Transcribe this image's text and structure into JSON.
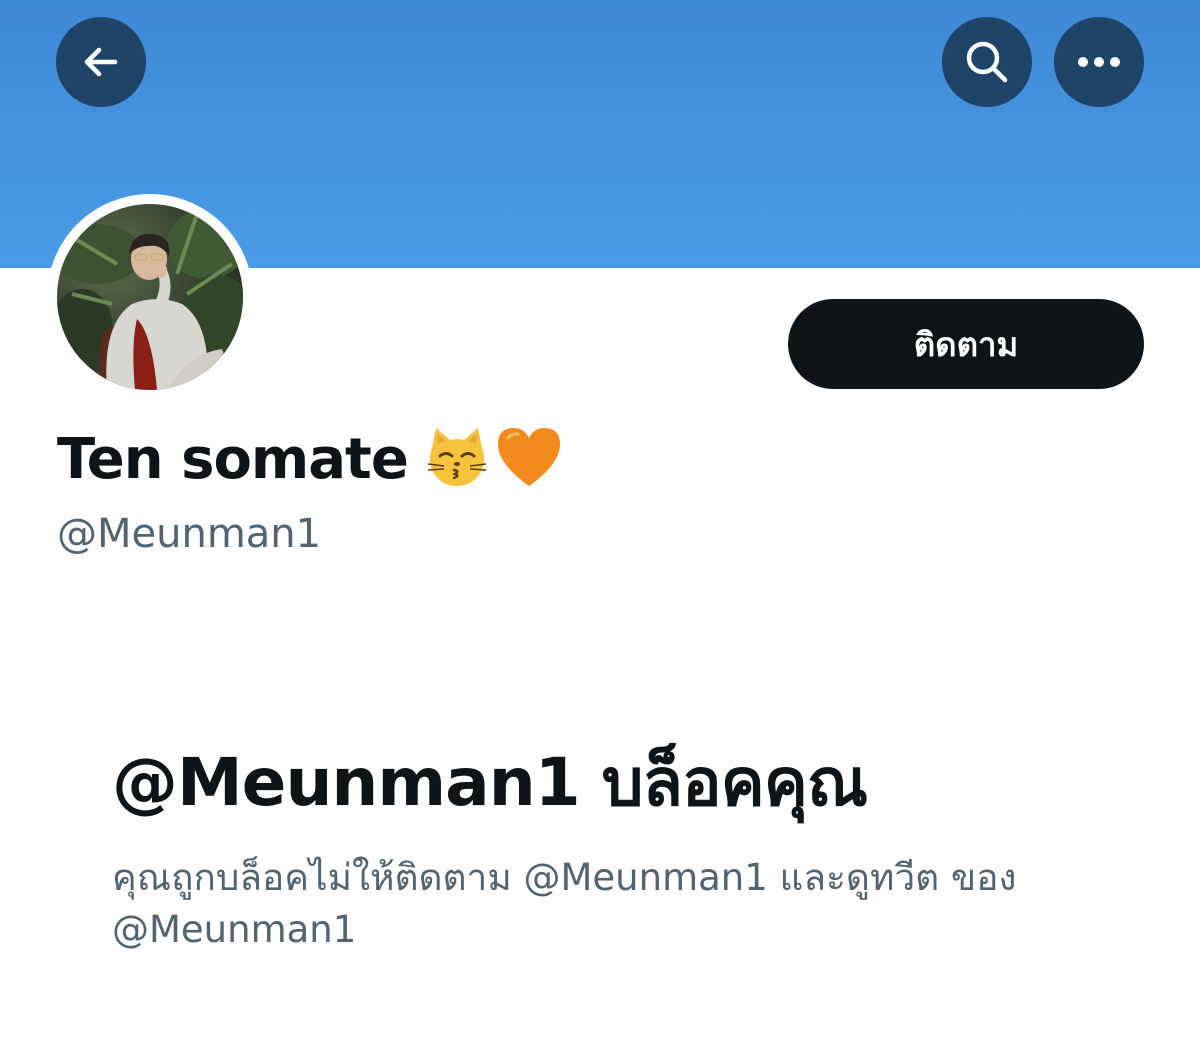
{
  "header": {
    "back_icon": "arrow-left-icon",
    "search_icon": "search-icon",
    "more_icon": "more-horizontal-icon",
    "banner_color": "#4a9be6"
  },
  "profile": {
    "display_name": "Ten somate",
    "emojis": [
      "kissing-cat-emoji",
      "orange-heart-emoji"
    ],
    "handle": "@Meunman1",
    "follow_label": "ติดตาม"
  },
  "blocked": {
    "title": "@Meunman1 บล็อคคุณ",
    "description": "คุณถูกบล็อคไม่ให้ติดตาม @Meunman1 และดูทวีต ของ @Meunman1"
  },
  "colors": {
    "text_primary": "#0f1419",
    "text_secondary": "#536471",
    "button_dark": "#0f1419",
    "header_button": "#1f4468"
  }
}
